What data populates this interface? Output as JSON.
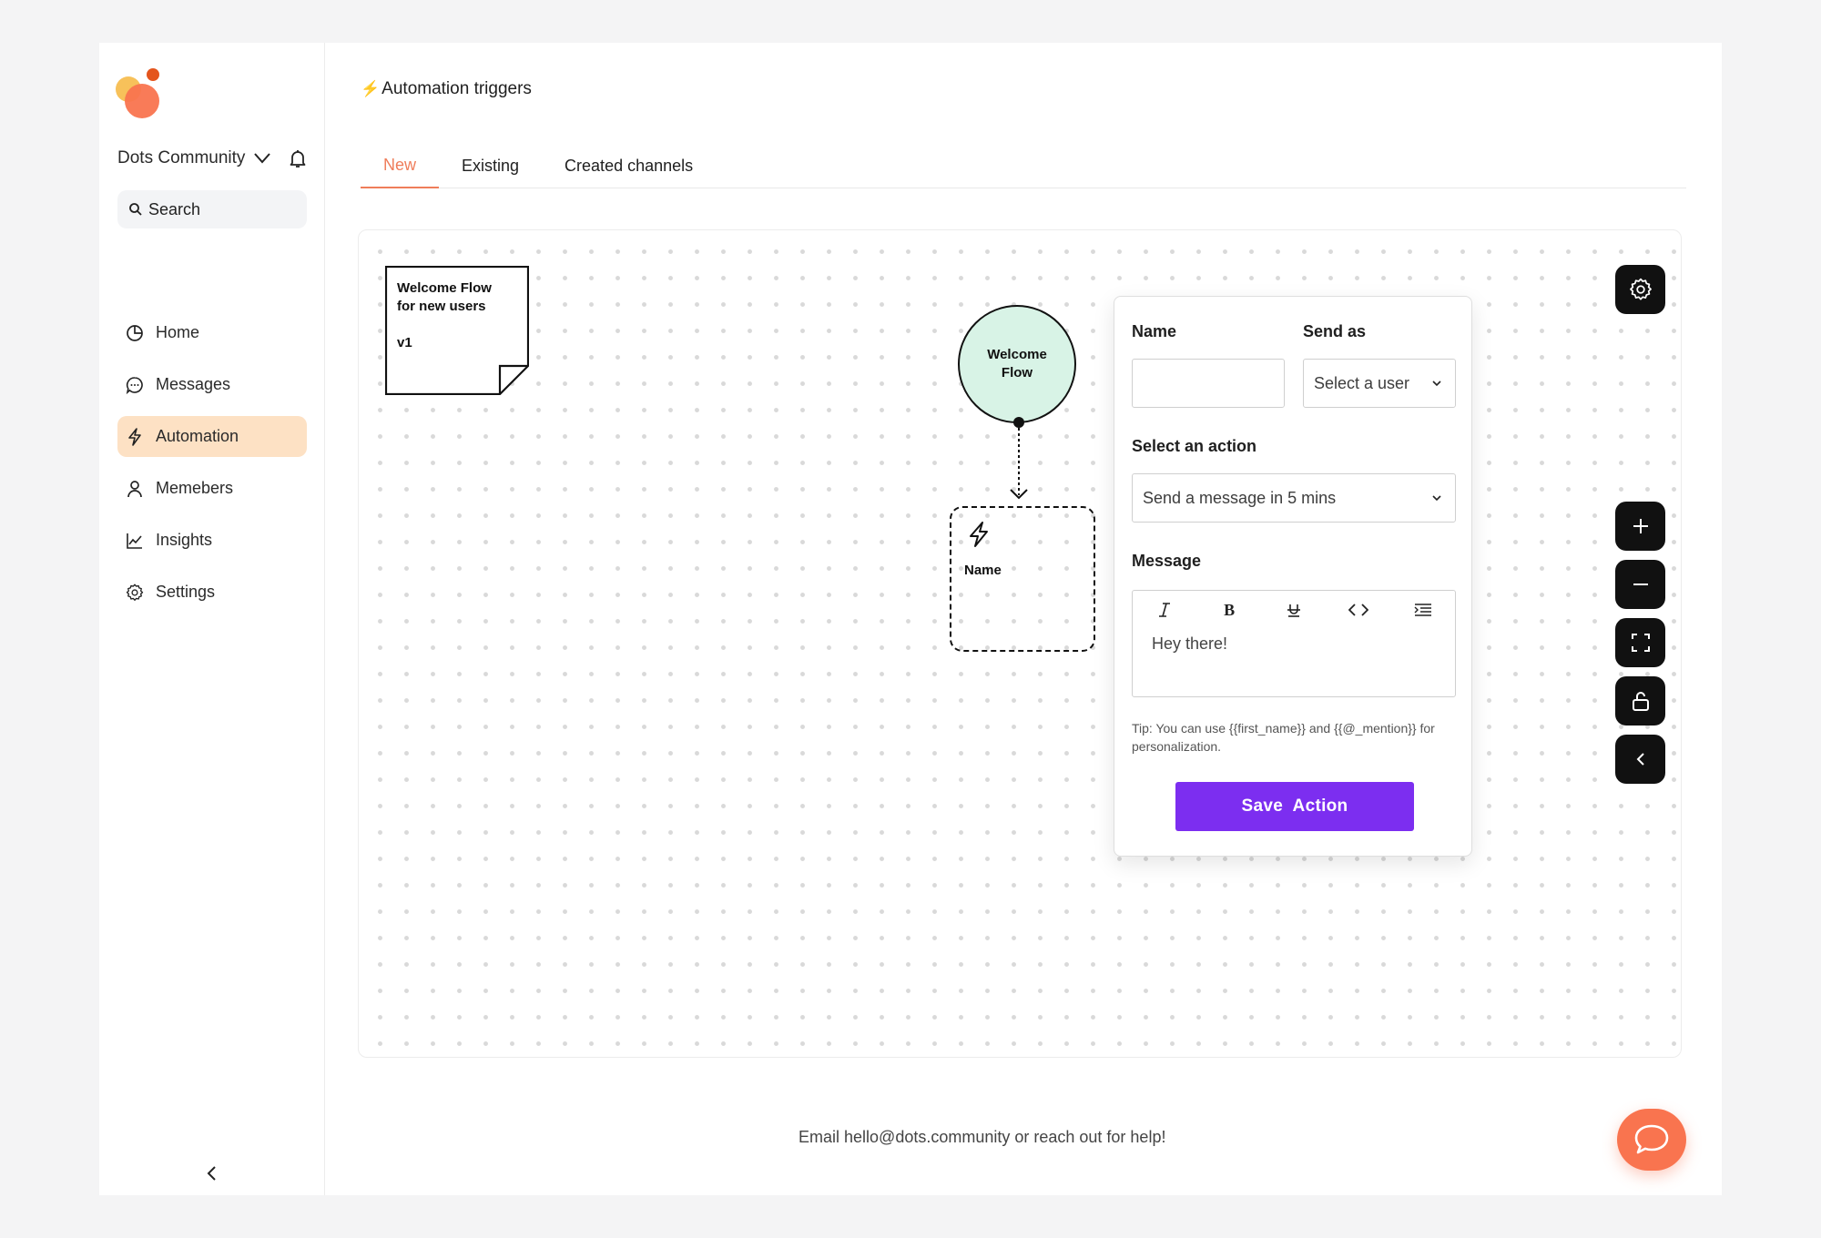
{
  "sidebar": {
    "workspace_name": "Dots Community",
    "search_label": "Search",
    "nav": [
      {
        "label": "Home",
        "icon": "pie-chart-icon"
      },
      {
        "label": "Messages",
        "icon": "chat-bubble-icon"
      },
      {
        "label": "Automation",
        "icon": "lightning-icon",
        "active": true
      },
      {
        "label": "Memebers",
        "icon": "user-icon"
      },
      {
        "label": "Insights",
        "icon": "line-chart-icon"
      },
      {
        "label": "Settings",
        "icon": "gear-icon"
      }
    ]
  },
  "header": {
    "title": "Automation triggers",
    "tabs": [
      {
        "label": "New",
        "active": true
      },
      {
        "label": "Existing"
      },
      {
        "label": "Created channels"
      }
    ]
  },
  "canvas": {
    "note": {
      "title": "Welcome Flow for new users",
      "version": "v1"
    },
    "flow_node": "Welcome Flow",
    "action_node": "Name"
  },
  "panel": {
    "name_label": "Name",
    "name_value": "",
    "send_as_label": "Send as",
    "send_as_value": "Select a user",
    "action_label": "Select an action",
    "action_value": "Send a message in 5 mins",
    "message_label": "Message",
    "message_text": "Hey there!",
    "tip": "Tip: You can use {{first_name}} and {{@_mention}} for personalization.",
    "save_button": "Save  Action"
  },
  "footer": {
    "help_text": "Email hello@dots.community or reach out for help!"
  },
  "colors": {
    "accent_orange": "#ef7d5a",
    "active_nav_bg": "#fde1c4",
    "primary_button": "#7c2ef0",
    "flow_node_fill": "#d8f3e6",
    "chat_fab": "#f9744f"
  }
}
